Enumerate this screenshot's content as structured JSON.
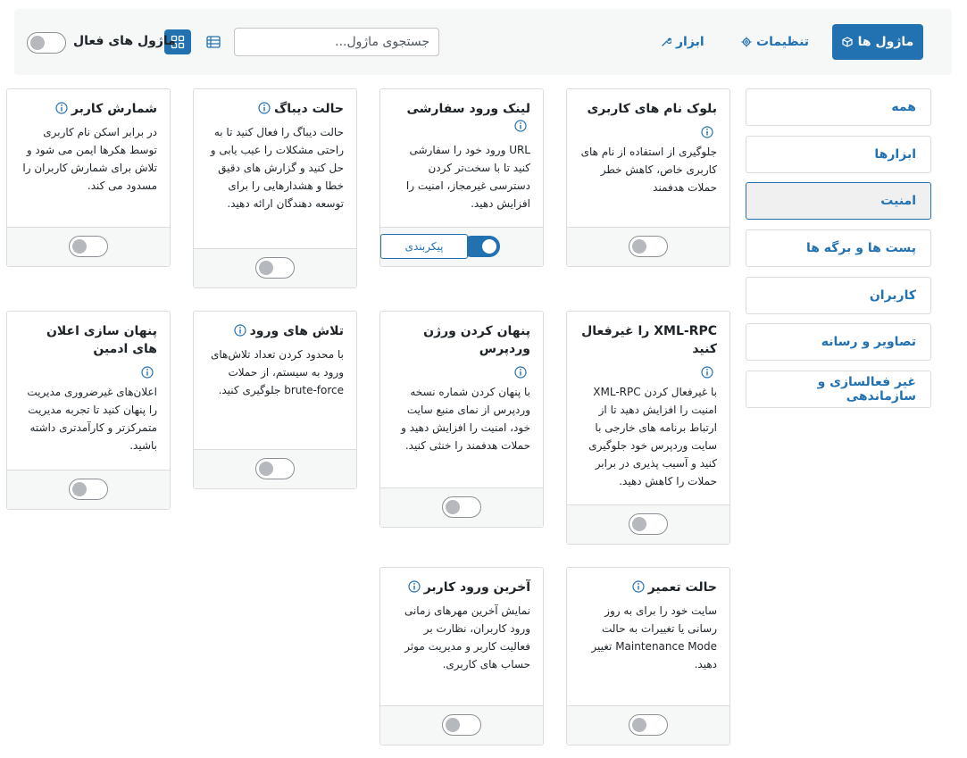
{
  "header": {
    "modules_tab": "ماژول ها",
    "settings_tab": "تنظیمات",
    "tools_tab": "ابزار",
    "search_placeholder": "جستجوی ماژول...",
    "active_modules_label": "ماژول های فعال",
    "active_modules_toggle": false
  },
  "sidebar": {
    "items": [
      {
        "label": "همه",
        "active": false
      },
      {
        "label": "ابزارها",
        "active": false
      },
      {
        "label": "امنیت",
        "active": true
      },
      {
        "label": "پست ها و برگه ها",
        "active": false
      },
      {
        "label": "کاربران",
        "active": false
      },
      {
        "label": "تصاویر و رسانه",
        "active": false
      },
      {
        "label": "غیر فعالسازی و سازماندهی",
        "active": false
      }
    ]
  },
  "modules": [
    {
      "title": "بلوک نام های کاربری",
      "desc": "جلوگیری از استفاده از نام های کاربری خاص، کاهش خطر حملات هدفمند",
      "enabled": false
    },
    {
      "title": "لینک ورود سفارشی",
      "desc": "URL ورود خود را سفارشی کنید تا با سخت‌تر کردن دسترسی غیرمجاز، امنیت را افزایش دهید.",
      "enabled": true,
      "config_label": "پیکربندی"
    },
    {
      "title": "حالت دیباگ",
      "desc": "حالت دیباگ را فعال کنید تا به راحتی مشکلات را عیب یابی و حل کنید و گزارش های دقیق خطا و هشدارهایی را برای توسعه دهندگان ارائه دهید.",
      "enabled": false
    },
    {
      "title": "شمارش کاربر",
      "desc": "در برابر اسکن نام کاربری توسط هکرها ایمن می شود و تلاش برای شمارش کاربران را مسدود می کند.",
      "enabled": false
    },
    {
      "title": "XML-RPC را غیرفعال کنید",
      "desc": "با غیرفعال کردن XML-RPC امنیت را افزایش دهید تا از ارتباط برنامه های خارجی با سایت وردپرس خود جلوگیری کنید و آسیب پذیری در برابر حملات را کاهش دهید.",
      "enabled": false
    },
    {
      "title": "پنهان کردن ورژن وردپرس",
      "desc": "با پنهان کردن شماره نسخه وردپرس از نمای منبع سایت خود، امنیت را افزایش دهید و حملات هدفمند را خنثی کنید.",
      "enabled": false
    },
    {
      "title": "تلاش های ورود",
      "desc": "با محدود کردن تعداد تلاش‌های ورود به سیستم، از حملات brute-force جلوگیری کنید.",
      "enabled": false
    },
    {
      "title": "پنهان سازی اعلان های ادمین",
      "desc": "اعلان‌های غیرضروری مدیریت را پنهان کنید تا تجربه مدیریت متمرکزتر و کارآمدتری داشته باشید.",
      "enabled": false
    },
    {
      "title": "حالت تعمیر",
      "desc": "سایت خود را برای به روز رسانی یا تغییرات به حالت Maintenance Mode تغییر دهید.",
      "enabled": false
    },
    {
      "title": "آخرین ورود کاربر",
      "desc": "نمایش آخرین مهرهای زمانی ورود کاربران، نظارت بر فعالیت کاربر و مدیریت موثر حساب های کاربری.",
      "enabled": false
    }
  ],
  "colors": {
    "accent": "#2271b1",
    "bar_bg": "#f6f7f7",
    "border": "#dcdcde"
  }
}
